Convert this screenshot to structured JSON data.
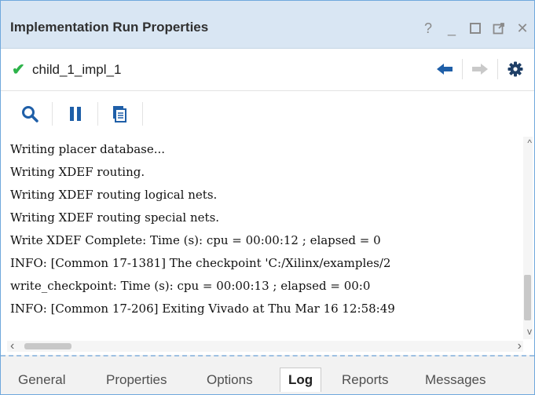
{
  "window": {
    "title": "Implementation Run Properties",
    "controls": [
      "help-icon",
      "minimize-icon",
      "maximize-icon",
      "float-icon",
      "close-icon"
    ],
    "help_label": "?",
    "minimize_label": "_",
    "close_label": "✕"
  },
  "run": {
    "status_icon": "check-icon",
    "status_color": "#2db34a",
    "name": "child_1_impl_1"
  },
  "toolbar": {
    "buttons": [
      "search-icon",
      "pause-icon",
      "copy-icon"
    ]
  },
  "log": {
    "lines": [
      "Writing placer database...",
      "Writing XDEF routing.",
      "Writing XDEF routing logical nets.",
      "Writing XDEF routing special nets.",
      "Write XDEF Complete: Time (s): cpu = 00:00:12 ; elapsed = 0",
      "INFO: [Common 17-1381] The checkpoint 'C:/Xilinx/examples/2",
      "write_checkpoint: Time (s): cpu = 00:00:13 ; elapsed = 00:0",
      "INFO: [Common 17-206] Exiting Vivado at Thu Mar 16 12:58:49"
    ]
  },
  "tabs": [
    {
      "label": "General",
      "active": false
    },
    {
      "label": "Properties",
      "active": false
    },
    {
      "label": "Options",
      "active": false
    },
    {
      "label": "Log",
      "active": true
    },
    {
      "label": "Reports",
      "active": false
    },
    {
      "label": "Messages",
      "active": false
    }
  ],
  "colors": {
    "accent": "#1f5fa8",
    "title_bar": "#d9e6f3",
    "check": "#2db34a"
  }
}
